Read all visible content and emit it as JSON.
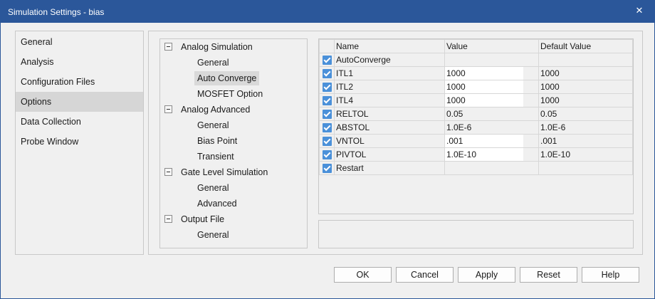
{
  "window": {
    "title": "Simulation Settings - bias",
    "close_glyph": "✕"
  },
  "nav": {
    "items": [
      {
        "label": "General"
      },
      {
        "label": "Analysis"
      },
      {
        "label": "Configuration Files"
      },
      {
        "label": "Options",
        "selected": true
      },
      {
        "label": "Data Collection"
      },
      {
        "label": "Probe Window"
      }
    ]
  },
  "tree": {
    "nodes": [
      {
        "label": "Analog Simulation",
        "level": 0
      },
      {
        "label": "General",
        "level": 1
      },
      {
        "label": "Auto Converge",
        "level": 1,
        "selected": true
      },
      {
        "label": "MOSFET Option",
        "level": 1
      },
      {
        "label": "Analog Advanced",
        "level": 0
      },
      {
        "label": "General",
        "level": 1
      },
      {
        "label": "Bias Point",
        "level": 1
      },
      {
        "label": "Transient",
        "level": 1
      },
      {
        "label": "Gate Level Simulation",
        "level": 0
      },
      {
        "label": "General",
        "level": 1
      },
      {
        "label": "Advanced",
        "level": 1
      },
      {
        "label": "Output File",
        "level": 0
      },
      {
        "label": "General",
        "level": 1
      }
    ]
  },
  "grid": {
    "headers": {
      "name": "Name",
      "value": "Value",
      "default": "Default Value"
    },
    "rows": [
      {
        "name": "AutoConverge",
        "value": "",
        "default": "",
        "checked": true
      },
      {
        "name": "ITL1",
        "value": "1000",
        "default": "1000",
        "checked": true
      },
      {
        "name": "ITL2",
        "value": "1000",
        "default": "1000",
        "checked": true
      },
      {
        "name": "ITL4",
        "value": "1000",
        "default": "1000",
        "checked": true
      },
      {
        "name": "RELTOL",
        "value": "0.05",
        "default": "0.05",
        "checked": true
      },
      {
        "name": "ABSTOL",
        "value": "1.0E-6",
        "default": "1.0E-6",
        "checked": true
      },
      {
        "name": "VNTOL",
        "value": ".001",
        "default": ".001",
        "checked": true
      },
      {
        "name": "PIVTOL",
        "value": "1.0E-10",
        "default": "1.0E-10",
        "checked": true
      },
      {
        "name": "Restart",
        "value": "",
        "default": "",
        "checked": true
      }
    ]
  },
  "buttons": {
    "ok": "OK",
    "cancel": "Cancel",
    "apply": "Apply",
    "reset": "Reset",
    "help": "Help"
  },
  "colors": {
    "titlebar": "#2b579a",
    "checkbox": "#4a90d9",
    "selected": "#d6d6d6"
  }
}
